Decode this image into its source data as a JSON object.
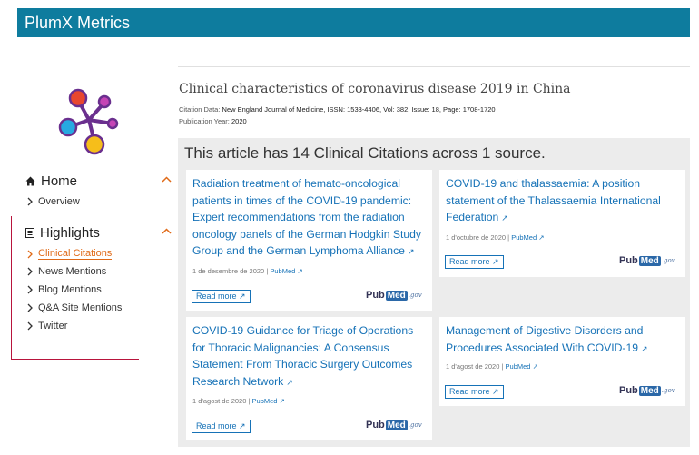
{
  "app": {
    "title": "PlumX Metrics"
  },
  "sidebar": {
    "sections": [
      {
        "label": "Home",
        "icon": "home-icon",
        "items": [
          {
            "label": "Overview"
          }
        ]
      },
      {
        "label": "Highlights",
        "icon": "highlights-icon",
        "items": [
          {
            "label": "Clinical Citations",
            "active": true
          },
          {
            "label": "News Mentions"
          },
          {
            "label": "Blog Mentions"
          },
          {
            "label": "Q&A Site Mentions"
          },
          {
            "label": "Twitter"
          }
        ]
      }
    ]
  },
  "article": {
    "title": "Clinical characteristics of coronavirus disease 2019 in China",
    "citation_label": "Citation Data:",
    "citation_value": "New England Journal of Medicine, ISSN: 1533-4406, Vol: 382, Issue: 18, Page: 1708-1720",
    "pubyear_label": "Publication Year:",
    "pubyear_value": "2020"
  },
  "panel": {
    "heading": "This article has 14 Clinical Citations across 1 source.",
    "cards": [
      {
        "title": "Radiation treatment of hemato-oncological patients in times of the COVID-19 pandemic: Expert recommendations from the radiation oncology panels of the German Hodgkin Study Group and the German Lymphoma Alliance",
        "date": "1 de desembre de 2020",
        "source": "PubMed",
        "read_more": "Read more"
      },
      {
        "title": "COVID-19 and thalassaemia: A position statement of the Thalassaemia International Federation",
        "date": "1 d'octubre de 2020",
        "source": "PubMed",
        "read_more": "Read more"
      },
      {
        "title": "COVID-19 Guidance for Triage of Operations for Thoracic Malignancies: A Consensus Statement From Thoracic Surgery Outcomes Research Network",
        "date": "1 d'agost de 2020",
        "source": "PubMed",
        "read_more": "Read more"
      },
      {
        "title": "Management of Digestive Disorders and Procedures Associated With COVID-19",
        "date": "1 d'agost de 2020",
        "source": "PubMed",
        "read_more": "Read more"
      }
    ]
  },
  "pubmed_logo": {
    "pub": "Pub",
    "med": "Med",
    "gov": ".gov"
  },
  "colors": {
    "brand": "#0e7c9e",
    "link": "#1672b7",
    "accent": "#e06a18",
    "sidebar_border": "#b8143c"
  }
}
